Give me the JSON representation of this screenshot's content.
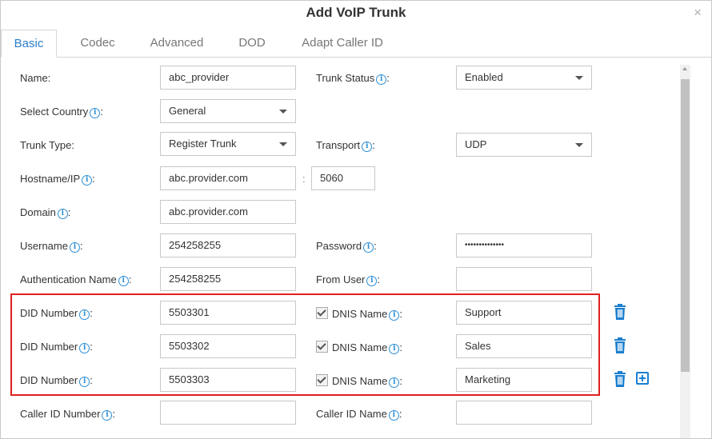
{
  "dialog": {
    "title": "Add VoIP Trunk",
    "close": "×"
  },
  "tabs": [
    {
      "label": "Basic",
      "active": true
    },
    {
      "label": "Codec"
    },
    {
      "label": "Advanced"
    },
    {
      "label": "DOD"
    },
    {
      "label": "Adapt Caller ID"
    }
  ],
  "form": {
    "name": {
      "label": "Name:",
      "value": "abc_provider"
    },
    "trunk_status": {
      "label": "Trunk Status",
      "value": "Enabled"
    },
    "select_country": {
      "label": "Select Country",
      "value": "General"
    },
    "trunk_type": {
      "label": "Trunk Type:",
      "value": "Register Trunk"
    },
    "transport": {
      "label": "Transport",
      "value": "UDP"
    },
    "hostname": {
      "label": "Hostname/IP",
      "value": "abc.provider.com",
      "port": "5060",
      "port_sep": ":"
    },
    "domain": {
      "label": "Domain",
      "value": "abc.provider.com"
    },
    "username": {
      "label": "Username",
      "value": "254258255"
    },
    "password": {
      "label": "Password",
      "value": "••••••••••••••"
    },
    "auth_name": {
      "label": "Authentication Name",
      "value": "254258255"
    },
    "from_user": {
      "label": "From User",
      "value": ""
    },
    "did_rows": [
      {
        "label": "DID Number",
        "value": "5503301",
        "dnis_label": "DNIS Name",
        "dnis_value": "Support",
        "dnis_checked": true
      },
      {
        "label": "DID Number",
        "value": "5503302",
        "dnis_label": "DNIS Name",
        "dnis_value": "Sales",
        "dnis_checked": true
      },
      {
        "label": "DID Number",
        "value": "5503303",
        "dnis_label": "DNIS Name",
        "dnis_value": "Marketing",
        "dnis_checked": true
      }
    ],
    "caller_id_number": {
      "label": "Caller ID Number",
      "value": ""
    },
    "caller_id_name": {
      "label": "Caller ID Name",
      "value": ""
    }
  },
  "colors": {
    "accent": "#2b7dc9",
    "highlight_border": "#e02020",
    "icon_blue": "#1a7fd0"
  },
  "icons": {
    "info": "info-icon",
    "delete": "trash-icon",
    "add": "add-icon"
  },
  "glyphs": {
    "info": "i",
    "colon": ":"
  }
}
